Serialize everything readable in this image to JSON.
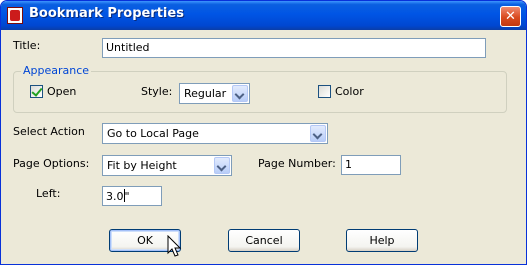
{
  "window": {
    "title": "Bookmark Properties",
    "close_glyph": "✕"
  },
  "title_field": {
    "label": "Title:",
    "value": "Untitled"
  },
  "appearance": {
    "legend": "Appearance",
    "open_label": "Open",
    "open_checked": true,
    "style_label": "Style:",
    "style_value": "Regular",
    "color_label": "Color",
    "color_checked": false
  },
  "action": {
    "label": "Select Action",
    "value": "Go to Local Page"
  },
  "page_options": {
    "label": "Page Options:",
    "value": "Fit by Height"
  },
  "page_number": {
    "label": "Page Number:",
    "value": "1"
  },
  "left": {
    "label": "Left:",
    "value": "3.0\""
  },
  "buttons": {
    "ok": "OK",
    "cancel": "Cancel",
    "help": "Help"
  },
  "icons": {
    "app": "app-icon",
    "close": "close-icon",
    "cursor": "mouse-pointer-icon"
  },
  "colors": {
    "titlebar": "#0055e5",
    "dialog": "#ece9d8",
    "legend": "#0046d5",
    "check": "#21a121"
  }
}
